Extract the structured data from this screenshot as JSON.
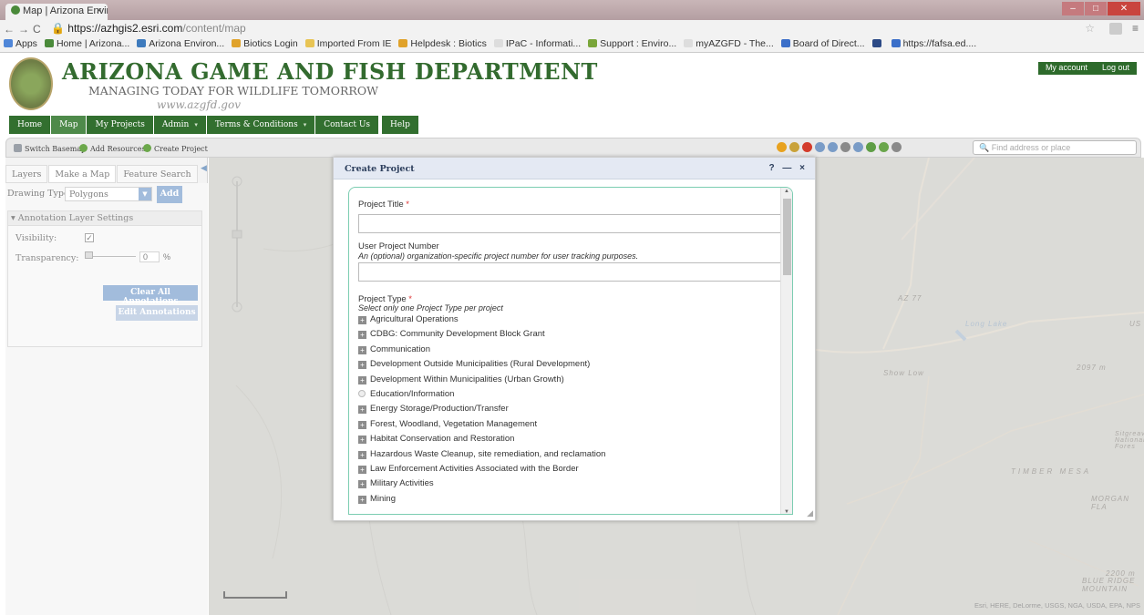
{
  "browser": {
    "tab_title": "Map | Arizona Enviro",
    "tab_close": "×",
    "url_host": "https://azhgis2.esri.com",
    "url_path": "/content/map",
    "nav_buttons": [
      "←",
      "→",
      "C"
    ],
    "bookmarks": [
      {
        "label": "Apps",
        "color": "#4f86d8"
      },
      {
        "label": "Home | Arizona...",
        "color": "#4a8a3a"
      },
      {
        "label": "Arizona Environ...",
        "color": "#3e7bbd"
      },
      {
        "label": "Biotics Login",
        "color": "#e0a22a"
      },
      {
        "label": "Imported From IE",
        "color": "#e8c454"
      },
      {
        "label": "Helpdesk : Biotics",
        "color": "#e0a22a"
      },
      {
        "label": "IPaC - Informati...",
        "color": "#dddddd"
      },
      {
        "label": "Support : Enviro...",
        "color": "#7aa63a"
      },
      {
        "label": "myAZGFD - The...",
        "color": "#dddddd"
      },
      {
        "label": "Board of Direct...",
        "color": "#3b6fc9"
      },
      {
        "label": "",
        "color": "#2c4a86"
      },
      {
        "label": "https://fafsa.ed....",
        "color": "#3b6fc9"
      }
    ]
  },
  "site": {
    "title": "ARIZONA GAME AND FISH DEPARTMENT",
    "subtitle": "MANAGING TODAY FOR WILDLIFE TOMORROW",
    "url": "www.azgfd.gov",
    "account_links": [
      "My account",
      "Log out"
    ],
    "nav": [
      {
        "label": "Home",
        "dropdown": false
      },
      {
        "label": "Map",
        "dropdown": false
      },
      {
        "label": "My Projects",
        "dropdown": false
      },
      {
        "label": "Admin",
        "dropdown": true
      },
      {
        "label": "Terms & Conditions",
        "dropdown": true
      },
      {
        "label": "Contact Us",
        "dropdown": false
      },
      {
        "label": "Help",
        "dropdown": false
      }
    ]
  },
  "toolbar": {
    "switch_basemap": "Switch Basemap",
    "add_resources": "Add Resources",
    "create_project": "Create Project",
    "search_placeholder": "Find address or place",
    "tool_colors": [
      "#e8a21f",
      "#c9a23a",
      "#d33c2c",
      "#7a9cc7",
      "#7a9cc7",
      "#8a8a8a",
      "#7a9cc7",
      "#5f9e46",
      "#6aa64c",
      "#8a8a8a"
    ]
  },
  "left_panel": {
    "tabs": [
      "Layers",
      "Make a Map",
      "Feature Search"
    ],
    "drawing_type_label": "Drawing Type:",
    "drawing_type_value": "Polygons",
    "add_button": "Add",
    "annotation_header": "▾ Annotation Layer Settings",
    "visibility_label": "Visibility:",
    "visibility_checked": "✓",
    "transparency_label": "Transparency:",
    "transparency_value": "0",
    "percent": "%",
    "clear_button": "Clear All Annotations",
    "edit_button": "Edit Annotations"
  },
  "map": {
    "labels": {
      "show_low": "Show Low",
      "timber_mesa": "TIMBER MESA",
      "morgan_fla": "MORGAN FLA",
      "blue_ridge": "BLUE RIDGE MOUNTAIN",
      "long_lake": "Long Lake",
      "silgreaves": "Sitgreave National Fores",
      "elev_2097": "2097 m",
      "elev_2200": "2200 m",
      "us": "US",
      "az77": "AZ 77"
    },
    "attribution": "Esri, HERE, DeLorme, USGS, NGA, USDA, EPA, NPS"
  },
  "modal": {
    "title": "Create Project",
    "controls": "? — ×",
    "project_title_label": "Project Title",
    "required_marker": "*",
    "user_number_label": "User Project Number",
    "user_number_help": "An (optional) organization-specific project number for user tracking purposes.",
    "project_type_label": "Project Type",
    "project_type_help": "Select only one Project Type per project",
    "project_types": [
      {
        "label": "Agricultural Operations",
        "kind": "plus"
      },
      {
        "label": "CDBG: Community Development Block Grant",
        "kind": "plus"
      },
      {
        "label": "Communication",
        "kind": "plus"
      },
      {
        "label": "Development Outside Municipalities (Rural Development)",
        "kind": "plus"
      },
      {
        "label": "Development Within Municipalities (Urban Growth)",
        "kind": "plus"
      },
      {
        "label": "Education/Information",
        "kind": "radio"
      },
      {
        "label": "Energy Storage/Production/Transfer",
        "kind": "plus"
      },
      {
        "label": "Forest, Woodland, Vegetation Management",
        "kind": "plus"
      },
      {
        "label": "Habitat Conservation and Restoration",
        "kind": "plus"
      },
      {
        "label": "Hazardous Waste Cleanup, site remediation, and reclamation",
        "kind": "plus"
      },
      {
        "label": "Law Enforcement Activities Associated with the Border",
        "kind": "plus"
      },
      {
        "label": "Military Activities",
        "kind": "plus"
      },
      {
        "label": "Mining",
        "kind": "plus"
      }
    ]
  }
}
